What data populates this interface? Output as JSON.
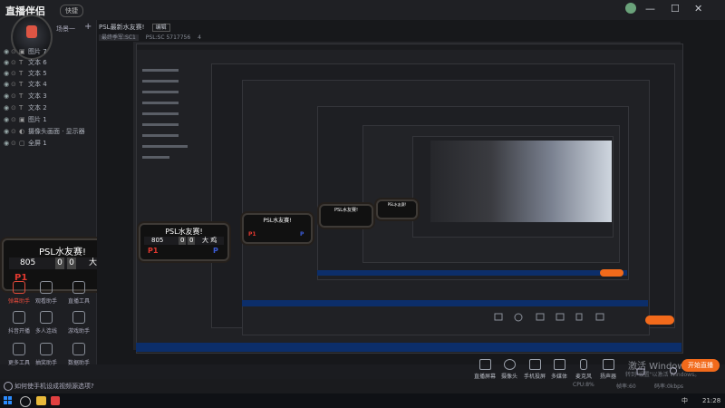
{
  "app": {
    "title": "直播伴侣",
    "badge": "快捷",
    "win_buttons": [
      "—",
      "☐",
      "✕"
    ],
    "top_right_icons": [
      "share-icon",
      "lock-icon",
      "copy-icon",
      "bell-icon",
      "settings-icon"
    ]
  },
  "sidebar": {
    "header": "场景一",
    "add": "+",
    "layers": [
      {
        "label": "图片 7",
        "icon": "▣"
      },
      {
        "label": "文本 6",
        "icon": "T"
      },
      {
        "label": "文本 5",
        "icon": "T"
      },
      {
        "label": "文本 4",
        "icon": "T"
      },
      {
        "label": "文本 3",
        "icon": "T"
      },
      {
        "label": "文本 2",
        "icon": "T"
      },
      {
        "label": "图片 1",
        "icon": "▣"
      },
      {
        "label": "摄像头画面 · 显示器",
        "icon": "◐"
      },
      {
        "label": "全屏 1",
        "icon": "▢"
      }
    ]
  },
  "scoreboard": {
    "title": "PSL水友赛!",
    "score_left": "805",
    "digit1": "0",
    "digit2": "0",
    "name": "大 鸡",
    "p1": "P1",
    "p2": "P"
  },
  "tools": [
    {
      "label": "弹幕助手",
      "color": "red"
    },
    {
      "label": "观看助手",
      "color": ""
    },
    {
      "label": "直播工具",
      "color": ""
    },
    {
      "label": "抖音开播",
      "color": ""
    },
    {
      "label": "多人连线",
      "color": ""
    },
    {
      "label": "游戏助手",
      "color": ""
    },
    {
      "label": "更多工具",
      "color": ""
    },
    {
      "label": "抽奖助手",
      "color": ""
    },
    {
      "label": "数据助手",
      "color": ""
    }
  ],
  "preview": {
    "title": "PSL最新水友赛!",
    "tag": "编辑",
    "subtitle": "最终季军:SC1",
    "time": "PSL:SC  5717756",
    "count": "4"
  },
  "controls": [
    {
      "label": "直播屏幕",
      "icon": "screen-icon"
    },
    {
      "label": "摄像头",
      "icon": "camera-icon"
    },
    {
      "label": "手机投屏",
      "icon": "phone-icon"
    },
    {
      "label": "多媒体",
      "icon": "media-icon"
    },
    {
      "label": "麦克风",
      "icon": "mic-icon"
    },
    {
      "label": "扬声器",
      "icon": "speaker-icon"
    }
  ],
  "golive": "开始直播",
  "watermark": {
    "line1": "激活 Windows",
    "line2": "转到\"设置\"以激活 Windows。"
  },
  "status": {
    "left": "如何使手机设成视频源选项?",
    "right1": "CPU:8%",
    "right2": "帧率:60",
    "right3": "码率:0kbps"
  },
  "taskbar": {
    "time": "21:28",
    "tray": "中"
  },
  "colors": {
    "accent": "#f26a1b",
    "p1": "#e0382f",
    "p2": "#3b5bd6",
    "taskbar_blue": "#0c2e6a"
  }
}
